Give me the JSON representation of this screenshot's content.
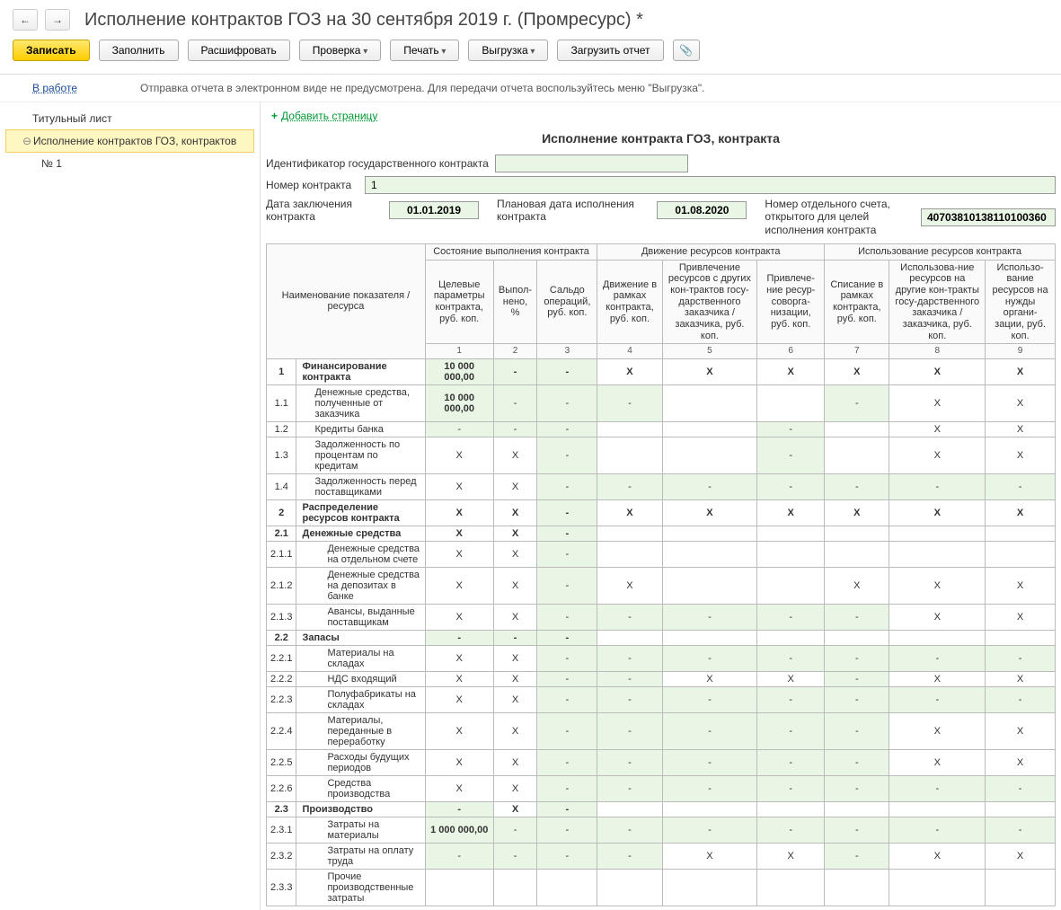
{
  "header": {
    "title": "Исполнение контрактов ГОЗ на 30 сентября 2019 г. (Промресурс) *",
    "status": "В работе",
    "info": "Отправка отчета в электронном виде не предусмотрена. Для передачи отчета воспользуйтесь меню \"Выгрузка\"."
  },
  "toolbar": {
    "save": "Записать",
    "fill": "Заполнить",
    "decode": "Расшифровать",
    "check": "Проверка",
    "print": "Печать",
    "export": "Выгрузка",
    "load": "Загрузить отчет"
  },
  "sidebar": {
    "item1": "Титульный лист",
    "item2": "Исполнение контрактов ГОЗ, контрактов",
    "sub1": "№ 1"
  },
  "addpage": "Добавить страницу",
  "section_title": "Исполнение контракта ГОЗ, контракта",
  "form": {
    "id_label": "Идентификатор государственного контракта",
    "id_value": "",
    "num_label": "Номер контракта",
    "num_value": "1",
    "date_label": "Дата заключения контракта",
    "date_value": "01.01.2019",
    "plan_label": "Плановая дата исполнения контракта",
    "plan_value": "01.08.2020",
    "acct_label": "Номер отдельного счета, открытого для целей исполнения контракта",
    "acct_value": "40703810138110100360"
  },
  "thead": {
    "name": "Наименование показателя / ресурса",
    "g1": "Состояние выполнения контракта",
    "g2": "Движение ресурсов контракта",
    "g3": "Использование ресурсов контракта",
    "c1": "Целевые параметры контракта, руб. коп.",
    "c2": "Выпол-нено, %",
    "c3": "Сальдо операций, руб. коп.",
    "c4": "Движение в рамках контракта, руб. коп.",
    "c5": "Привлечение ресурсов с других кон-трактов госу-дарственного заказчика / заказчика, руб. коп.",
    "c6": "Привлече-ние ресур-соворга-низации, руб. коп.",
    "c7": "Списание в рамках контракта, руб. коп.",
    "c8": "Использова-ние ресурсов на другие кон-тракты госу-дарственного заказчика / заказчика, руб. коп.",
    "c9": "Использо-вание ресурсов на нужды органи-зации, руб. коп."
  },
  "rows": [
    {
      "n": "1",
      "name": "Финансирование контракта",
      "bold": true,
      "c1": "10 000 000,00",
      "c2": "-",
      "c3": "-",
      "c4": "X",
      "c5": "X",
      "c6": "X",
      "c7": "X",
      "c8": "X",
      "c9": "X",
      "g": [
        0,
        1,
        1,
        1,
        0,
        0,
        0,
        0,
        0,
        0
      ]
    },
    {
      "n": "1.1",
      "name": "Денежные средства, полученные от заказчика",
      "ind": 1,
      "c1": "10 000 000,00",
      "c2": "-",
      "c3": "-",
      "c4": "-",
      "c5": "",
      "c6": "",
      "c7": "-",
      "c8": "X",
      "c9": "X",
      "g": [
        0,
        1,
        1,
        1,
        1,
        0,
        0,
        1,
        0,
        0
      ]
    },
    {
      "n": "1.2",
      "name": "Кредиты банка",
      "ind": 1,
      "c1": "-",
      "c2": "-",
      "c3": "-",
      "c4": "",
      "c5": "",
      "c6": "-",
      "c7": "",
      "c8": "X",
      "c9": "X",
      "g": [
        0,
        1,
        1,
        1,
        0,
        0,
        1,
        0,
        0,
        0
      ]
    },
    {
      "n": "1.3",
      "name": "Задолженность по процентам по кредитам",
      "ind": 1,
      "c1": "X",
      "c2": "X",
      "c3": "-",
      "c4": "",
      "c5": "",
      "c6": "-",
      "c7": "",
      "c8": "X",
      "c9": "X",
      "g": [
        0,
        0,
        0,
        1,
        0,
        0,
        1,
        0,
        0,
        0
      ]
    },
    {
      "n": "1.4",
      "name": "Задолженность перед поставщиками",
      "ind": 1,
      "c1": "X",
      "c2": "X",
      "c3": "-",
      "c4": "-",
      "c5": "-",
      "c6": "-",
      "c7": "-",
      "c8": "-",
      "c9": "-",
      "g": [
        0,
        0,
        0,
        1,
        1,
        1,
        1,
        1,
        1,
        1
      ]
    },
    {
      "n": "2",
      "name": "Распределение ресурсов контракта",
      "bold": true,
      "c1": "X",
      "c2": "X",
      "c3": "-",
      "c4": "X",
      "c5": "X",
      "c6": "X",
      "c7": "X",
      "c8": "X",
      "c9": "X",
      "g": [
        0,
        0,
        0,
        1,
        0,
        0,
        0,
        0,
        0,
        0
      ]
    },
    {
      "n": "2.1",
      "name": "Денежные средства",
      "bold": true,
      "c1": "X",
      "c2": "X",
      "c3": "-",
      "c4": "",
      "c5": "",
      "c6": "",
      "c7": "",
      "c8": "",
      "c9": "",
      "g": [
        0,
        0,
        0,
        1,
        0,
        0,
        0,
        0,
        0,
        0
      ]
    },
    {
      "n": "2.1.1",
      "name": "Денежные средства на отдельном счете",
      "ind": 2,
      "c1": "X",
      "c2": "X",
      "c3": "-",
      "c4": "",
      "c5": "",
      "c6": "",
      "c7": "",
      "c8": "",
      "c9": "",
      "g": [
        0,
        0,
        0,
        1,
        0,
        0,
        0,
        0,
        0,
        0
      ]
    },
    {
      "n": "2.1.2",
      "name": "Денежные средства на депозитах в банке",
      "ind": 2,
      "c1": "X",
      "c2": "X",
      "c3": "-",
      "c4": "X",
      "c5": "",
      "c6": "",
      "c7": "X",
      "c8": "X",
      "c9": "X",
      "g": [
        0,
        0,
        0,
        1,
        0,
        0,
        0,
        0,
        0,
        0
      ]
    },
    {
      "n": "2.1.3",
      "name": "Авансы, выданные поставщикам",
      "ind": 2,
      "c1": "X",
      "c2": "X",
      "c3": "-",
      "c4": "-",
      "c5": "-",
      "c6": "-",
      "c7": "-",
      "c8": "X",
      "c9": "X",
      "g": [
        0,
        0,
        0,
        1,
        1,
        1,
        1,
        1,
        0,
        0
      ]
    },
    {
      "n": "2.2",
      "name": "Запасы",
      "bold": true,
      "c1": "-",
      "c2": "-",
      "c3": "-",
      "c4": "",
      "c5": "",
      "c6": "",
      "c7": "",
      "c8": "",
      "c9": "",
      "g": [
        0,
        1,
        1,
        1,
        0,
        0,
        0,
        0,
        0,
        0
      ]
    },
    {
      "n": "2.2.1",
      "name": "Материалы на складах",
      "ind": 2,
      "c1": "X",
      "c2": "X",
      "c3": "-",
      "c4": "-",
      "c5": "-",
      "c6": "-",
      "c7": "-",
      "c8": "-",
      "c9": "-",
      "g": [
        0,
        0,
        0,
        1,
        1,
        1,
        1,
        1,
        1,
        1
      ]
    },
    {
      "n": "2.2.2",
      "name": "НДС входящий",
      "ind": 2,
      "c1": "X",
      "c2": "X",
      "c3": "-",
      "c4": "-",
      "c5": "X",
      "c6": "X",
      "c7": "-",
      "c8": "X",
      "c9": "X",
      "g": [
        0,
        0,
        0,
        1,
        1,
        0,
        0,
        1,
        0,
        0
      ]
    },
    {
      "n": "2.2.3",
      "name": "Полуфабрикаты на складах",
      "ind": 2,
      "c1": "X",
      "c2": "X",
      "c3": "-",
      "c4": "-",
      "c5": "-",
      "c6": "-",
      "c7": "-",
      "c8": "-",
      "c9": "-",
      "g": [
        0,
        0,
        0,
        1,
        1,
        1,
        1,
        1,
        1,
        1
      ]
    },
    {
      "n": "2.2.4",
      "name": "Материалы, переданные в переработку",
      "ind": 2,
      "c1": "X",
      "c2": "X",
      "c3": "-",
      "c4": "-",
      "c5": "-",
      "c6": "-",
      "c7": "-",
      "c8": "X",
      "c9": "X",
      "g": [
        0,
        0,
        0,
        1,
        1,
        1,
        1,
        1,
        0,
        0
      ]
    },
    {
      "n": "2.2.5",
      "name": "Расходы будущих периодов",
      "ind": 2,
      "c1": "X",
      "c2": "X",
      "c3": "-",
      "c4": "-",
      "c5": "-",
      "c6": "-",
      "c7": "-",
      "c8": "X",
      "c9": "X",
      "g": [
        0,
        0,
        0,
        1,
        1,
        1,
        1,
        1,
        0,
        0
      ]
    },
    {
      "n": "2.2.6",
      "name": "Средства производства",
      "ind": 2,
      "c1": "X",
      "c2": "X",
      "c3": "-",
      "c4": "-",
      "c5": "-",
      "c6": "-",
      "c7": "-",
      "c8": "-",
      "c9": "-",
      "g": [
        0,
        0,
        0,
        1,
        1,
        1,
        1,
        1,
        1,
        1
      ]
    },
    {
      "n": "2.3",
      "name": "Производство",
      "bold": true,
      "c1": "-",
      "c2": "X",
      "c3": "-",
      "c4": "",
      "c5": "",
      "c6": "",
      "c7": "",
      "c8": "",
      "c9": "",
      "g": [
        0,
        1,
        0,
        1,
        0,
        0,
        0,
        0,
        0,
        0
      ]
    },
    {
      "n": "2.3.1",
      "name": "Затраты на материалы",
      "ind": 2,
      "c1": "1 000 000,00",
      "c2": "-",
      "c3": "-",
      "c4": "-",
      "c5": "-",
      "c6": "-",
      "c7": "-",
      "c8": "-",
      "c9": "-",
      "g": [
        0,
        1,
        1,
        1,
        1,
        1,
        1,
        1,
        1,
        1
      ]
    },
    {
      "n": "2.3.2",
      "name": "Затраты на оплату труда",
      "ind": 2,
      "c1": "-",
      "c2": "-",
      "c3": "-",
      "c4": "-",
      "c5": "X",
      "c6": "X",
      "c7": "-",
      "c8": "X",
      "c9": "X",
      "g": [
        0,
        1,
        1,
        1,
        1,
        0,
        0,
        1,
        0,
        0
      ]
    },
    {
      "n": "2.3.3",
      "name": "Прочие производственные затраты",
      "ind": 2,
      "c1": "",
      "c2": "",
      "c3": "",
      "c4": "",
      "c5": "",
      "c6": "",
      "c7": "",
      "c8": "",
      "c9": "",
      "g": [
        0,
        0,
        0,
        0,
        0,
        0,
        0,
        0,
        0,
        0
      ]
    }
  ]
}
